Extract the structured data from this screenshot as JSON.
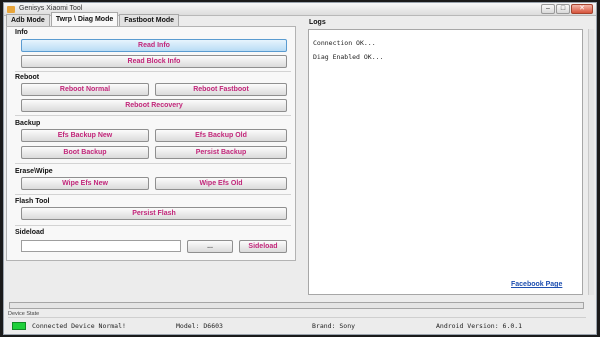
{
  "window": {
    "title": "Genisys Xiaomi Tool",
    "buttons": {
      "minimize": "–",
      "maximize": "□",
      "close": "✕"
    }
  },
  "tabs": [
    {
      "label": "Adb Mode",
      "active": false
    },
    {
      "label": "Twrp \\ Diag Mode",
      "active": true
    },
    {
      "label": "Fastboot Mode",
      "active": false
    }
  ],
  "info": {
    "label": "Info",
    "read_info": "Read Info",
    "read_block_info": "Read Block Info"
  },
  "reboot": {
    "label": "Reboot",
    "normal": "Reboot Normal",
    "fastboot": "Reboot Fastboot",
    "recovery": "Reboot Recovery"
  },
  "backup": {
    "label": "Backup",
    "efs_new": "Efs Backup New",
    "efs_old": "Efs Backup Old",
    "boot": "Boot Backup",
    "persist": "Persist Backup"
  },
  "erase": {
    "label": "Erase\\Wipe",
    "wipe_new": "Wipe Efs New",
    "wipe_old": "Wipe Efs Old"
  },
  "flash": {
    "label": "Flash Tool",
    "persist_flash": "Persist Flash"
  },
  "sideload": {
    "label": "Sideload",
    "path_value": "",
    "browse": "...",
    "sideload_button": "Sideload"
  },
  "logs": {
    "label": "Logs",
    "lines": [
      "Connection OK...",
      "Diag Enabled OK..."
    ],
    "facebook_link": "Facebook Page"
  },
  "status": {
    "device_state_label": "Device State",
    "indicator_color": "#1fd03a",
    "connection": "Connected Device Normal!",
    "model": "Model: D6603",
    "brand": "Brand: Sony",
    "android": "Android Version: 6.0.1"
  }
}
